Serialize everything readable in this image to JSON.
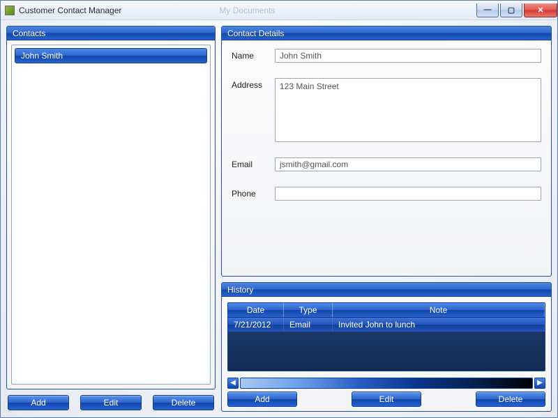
{
  "window": {
    "title": "Customer Contact Manager",
    "ghost_text": "My Documents"
  },
  "contacts_panel": {
    "header": "Contacts",
    "items": [
      {
        "name": "John Smith",
        "selected": true
      }
    ],
    "buttons": {
      "add": "Add",
      "edit": "Edit",
      "delete": "Delete"
    }
  },
  "details_panel": {
    "header": "Contact Details",
    "labels": {
      "name": "Name",
      "address": "Address",
      "email": "Email",
      "phone": "Phone"
    },
    "values": {
      "name": "John Smith",
      "address": "123 Main Street",
      "email": "jsmith@gmail.com",
      "phone": ""
    }
  },
  "history_panel": {
    "header": "History",
    "columns": {
      "date": "Date",
      "type": "Type",
      "note": "Note"
    },
    "rows": [
      {
        "date": "7/21/2012",
        "type": "Email",
        "note": "Invited John to lunch"
      }
    ],
    "buttons": {
      "add": "Add",
      "edit": "Edit",
      "delete": "Delete"
    }
  },
  "win_controls": {
    "min": "—",
    "max": "▢",
    "close": "✕"
  },
  "arrows": {
    "left": "◀",
    "right": "▶"
  }
}
